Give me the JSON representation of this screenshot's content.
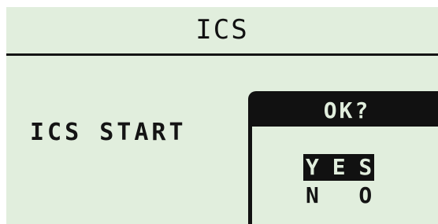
{
  "header": {
    "title": "ICS"
  },
  "main": {
    "label": "ICS START"
  },
  "dialog": {
    "title": "OK?",
    "options": [
      {
        "label": "Y E S",
        "selected": true
      },
      {
        "label": "N   O",
        "selected": false
      }
    ]
  },
  "colors": {
    "lcd_background": "#e1eedd",
    "foreground": "#111111"
  }
}
